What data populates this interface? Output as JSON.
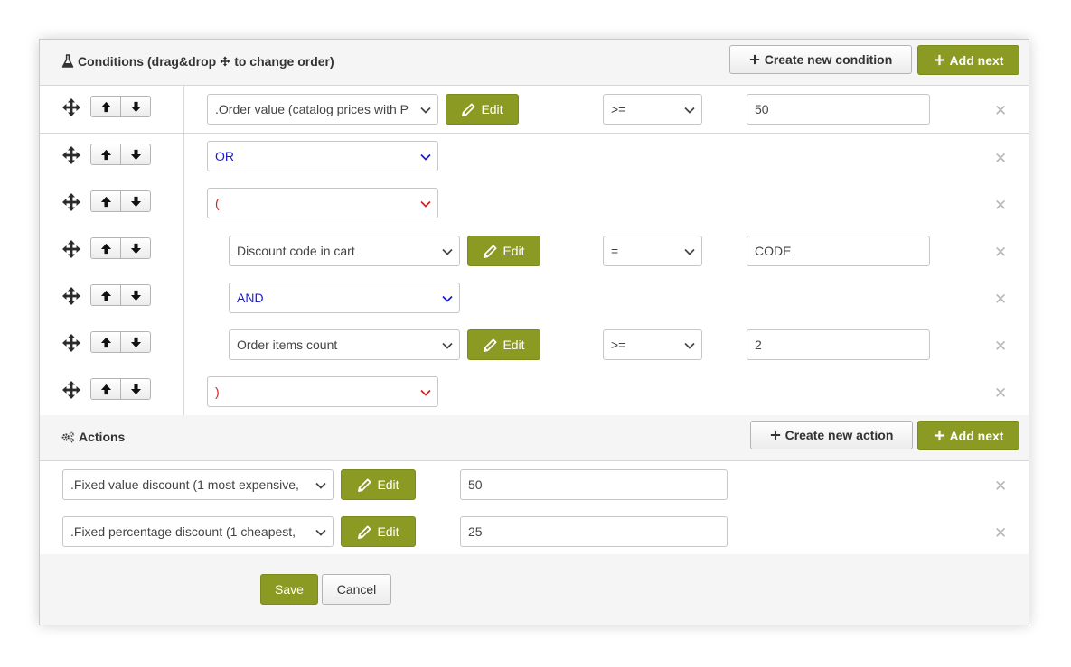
{
  "conditions": {
    "title": "Conditions (drag&drop",
    "title_suffix": "to change order)",
    "create_new_label": "Create new condition",
    "add_next_label": "Add next",
    "rows": [
      {
        "select": ".Order value (catalog prices with P",
        "edit_label": "Edit",
        "operator": ">=",
        "value": "50"
      },
      {
        "select": "OR"
      },
      {
        "select": "("
      },
      {
        "select": "Discount code in cart",
        "edit_label": "Edit",
        "operator": "=",
        "value": "CODE"
      },
      {
        "select": "AND"
      },
      {
        "select": "Order items count",
        "edit_label": "Edit",
        "operator": ">=",
        "value": "2"
      },
      {
        "select": ")"
      }
    ]
  },
  "actions": {
    "title": "Actions",
    "create_new_label": "Create new action",
    "add_next_label": "Add next",
    "rows": [
      {
        "select": ".Fixed value discount (1 most expensive,",
        "edit_label": "Edit",
        "value": "50"
      },
      {
        "select": ".Fixed percentage discount (1 cheapest,",
        "edit_label": "Edit",
        "value": "25"
      }
    ]
  },
  "footer": {
    "save_label": "Save",
    "cancel_label": "Cancel"
  },
  "colors": {
    "accent_green": "#8a9a22",
    "logic_blue": "#1a1ad6",
    "bracket_red": "#d62020"
  },
  "icons": {
    "move": "move-icon",
    "up": "arrow-up-icon",
    "down": "arrow-down-icon",
    "edit": "pencil-icon",
    "delete": "close-icon",
    "conditions": "flask-icon",
    "actions": "gears-icon",
    "plus": "plus-icon"
  }
}
